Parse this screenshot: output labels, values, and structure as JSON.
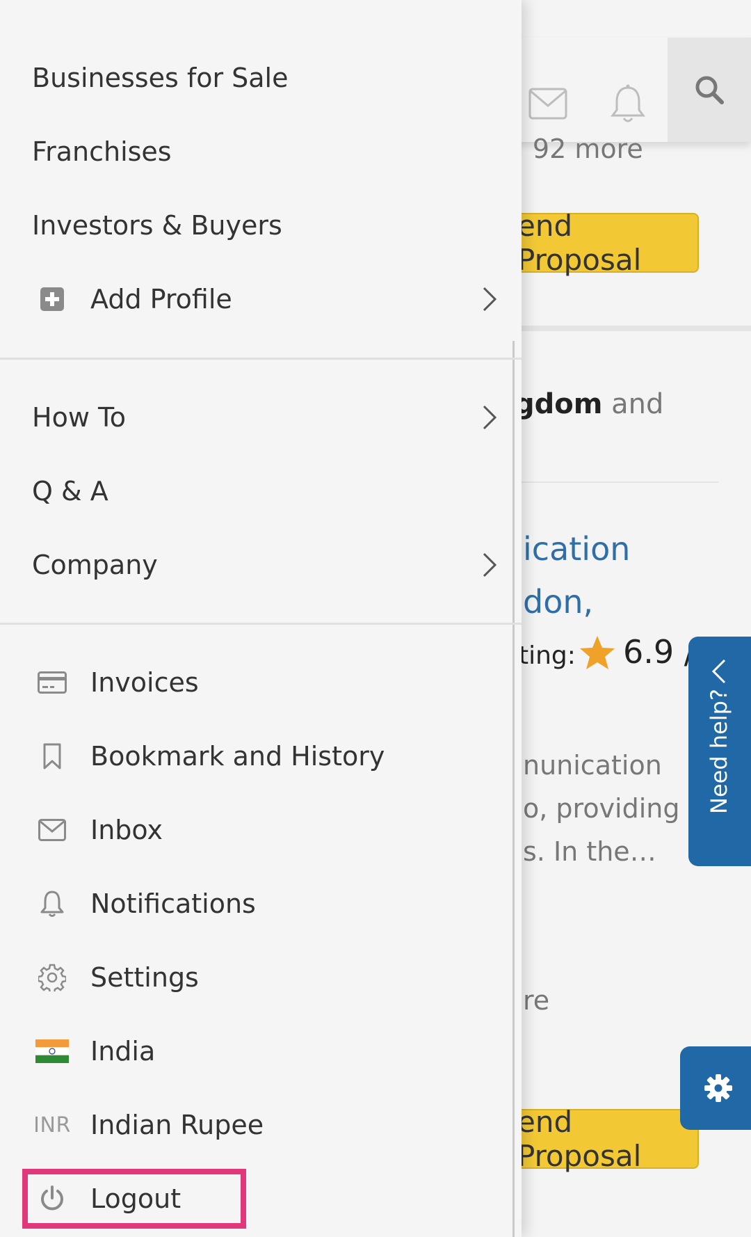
{
  "background": {
    "more_text": "+ 92 more",
    "send_proposal_1": "end Proposal",
    "kingdom_bold": "gdom",
    "kingdom_rest": " and",
    "link_line1": "ication",
    "link_line2": "don,",
    "rating_label": "ting:",
    "rating_value": "6.9 /",
    "desc_line1": "nunication",
    "desc_line2": "o, providing",
    "desc_line3": "s. In the…",
    "more_short": "re",
    "send_proposal_2": "end Proposal",
    "help_label": "Need help?",
    "colors": {
      "accent_blue": "#2168a6",
      "button_yellow": "#f2c935",
      "link_blue": "#2f6ea9",
      "star": "#f0a128"
    }
  },
  "drawer": {
    "group1": [
      {
        "label": "Businesses for Sale"
      },
      {
        "label": "Franchises"
      },
      {
        "label": "Investors & Buyers"
      },
      {
        "label": "Add Profile",
        "icon": "plus-square-icon",
        "has_submenu": true
      }
    ],
    "group2": [
      {
        "label": "How To",
        "has_submenu": true
      },
      {
        "label": "Q & A"
      },
      {
        "label": "Company",
        "has_submenu": true
      }
    ],
    "group3": [
      {
        "label": "Invoices",
        "icon": "credit-card-icon"
      },
      {
        "label": "Bookmark and History",
        "icon": "bookmark-icon"
      },
      {
        "label": "Inbox",
        "icon": "envelope-icon"
      },
      {
        "label": "Notifications",
        "icon": "bell-icon"
      },
      {
        "label": "Settings",
        "icon": "gear-icon"
      },
      {
        "label": "India",
        "icon": "india-flag-icon"
      },
      {
        "label": "Indian Rupee",
        "icon_text": "INR"
      },
      {
        "label": "Logout",
        "icon": "power-icon",
        "highlighted": true
      }
    ],
    "colors": {
      "highlight_border": "#e0387a",
      "icon_gray": "#8a8a8a"
    }
  }
}
